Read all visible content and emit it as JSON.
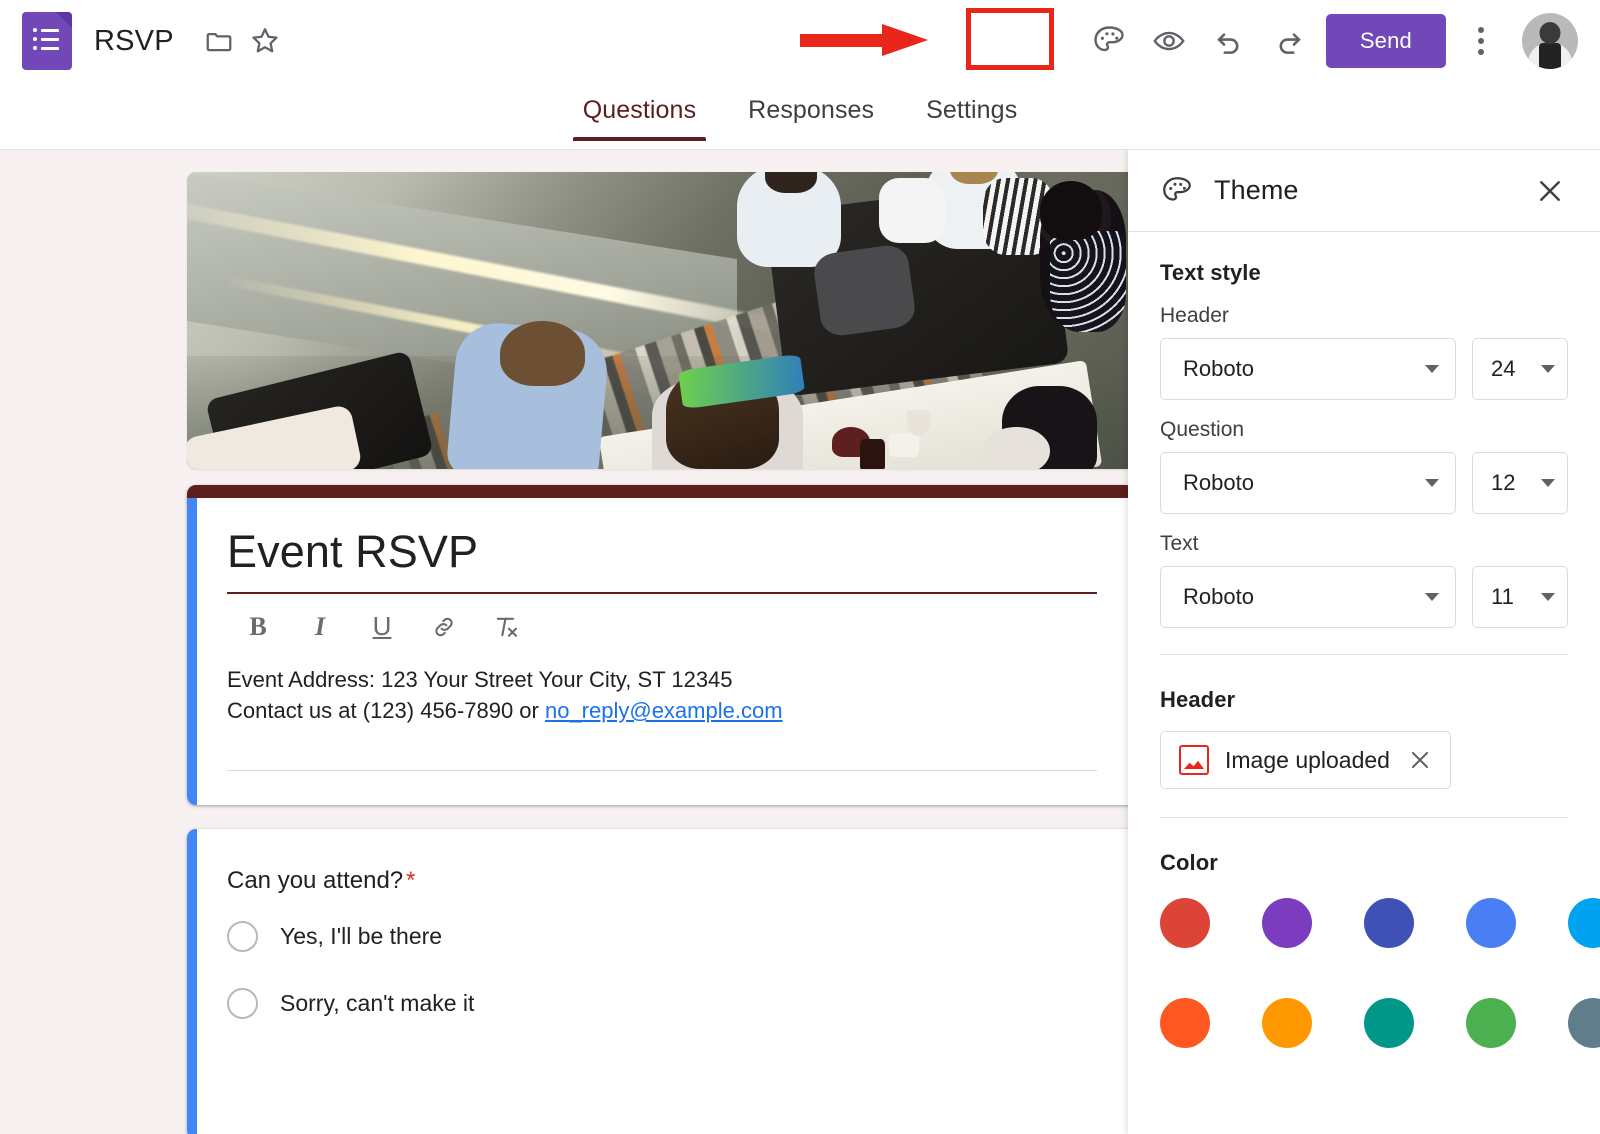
{
  "app": {
    "doc_title": "RSVP",
    "logo_name": "google-forms-logo"
  },
  "topbar": {
    "move_folder_label": "Move to folder",
    "star_label": "Star",
    "theme_label": "Customize theme",
    "preview_label": "Preview",
    "undo_label": "Undo",
    "redo_label": "Redo",
    "send_label": "Send",
    "more_label": "More options",
    "account_label": "Google Account"
  },
  "tabs": [
    {
      "label": "Questions",
      "active": true
    },
    {
      "label": "Responses",
      "active": false
    },
    {
      "label": "Settings",
      "active": false
    }
  ],
  "form": {
    "header_image_alt": "People socializing at an indoor party with drinks and food",
    "title": "Event RSVP",
    "description_line1": "Event Address: 123 Your Street Your City, ST 12345",
    "description_line2_prefix": "Contact us at (123) 456-7890 or ",
    "description_email": "no_reply@example.com",
    "format_tools": [
      {
        "name": "bold-icon",
        "glyph": "B"
      },
      {
        "name": "italic-icon",
        "glyph": "I"
      },
      {
        "name": "underline-icon",
        "glyph": "U"
      },
      {
        "name": "link-icon",
        "glyph": ""
      },
      {
        "name": "clear-formatting-icon",
        "glyph": ""
      }
    ],
    "question": {
      "text": "Can you attend?",
      "required_marker": "*",
      "options": [
        {
          "label": "Yes,  I'll be there"
        },
        {
          "label": "Sorry, can't make it"
        }
      ]
    },
    "accent_left_color": "#4285f4",
    "theme_color": "#5c1e1e"
  },
  "theme_panel": {
    "title": "Theme",
    "close_label": "Close",
    "text_style_heading": "Text style",
    "fields": [
      {
        "label": "Header",
        "font": "Roboto",
        "size": "24"
      },
      {
        "label": "Question",
        "font": "Roboto",
        "size": "12"
      },
      {
        "label": "Text",
        "font": "Roboto",
        "size": "11"
      }
    ],
    "header_heading": "Header",
    "header_chip_label": "Image uploaded",
    "color_heading": "Color",
    "colors": [
      "#db4437",
      "#7b3cc0",
      "#3f51b5",
      "#4a7ef5",
      "#00a3f0",
      "#00c3d9",
      "#ff5722",
      "#ff9800",
      "#009688",
      "#4caf50",
      "#607d8b",
      "#9e9e9e"
    ]
  },
  "annotation": {
    "arrow_color": "#e8271a",
    "highlight_color": "#e8271a",
    "points_to": "theme-button"
  }
}
